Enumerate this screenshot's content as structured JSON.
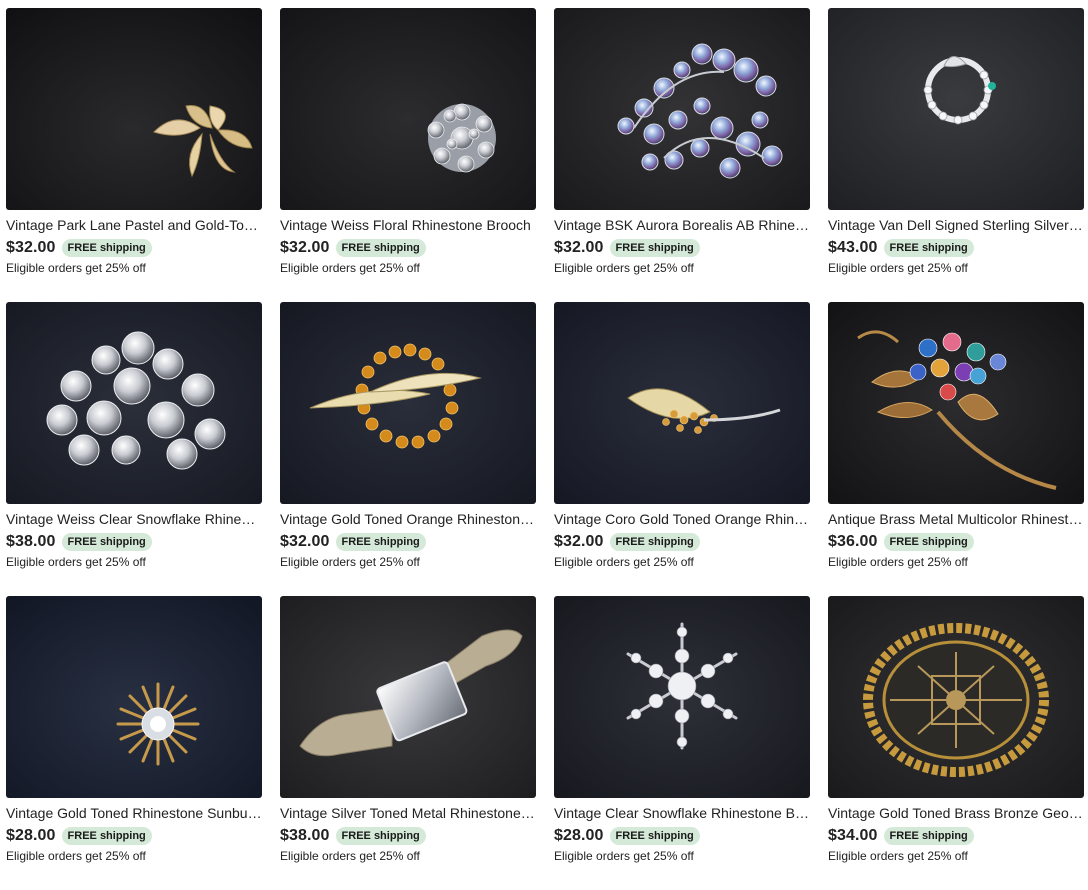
{
  "listings": [
    {
      "title": "Vintage Park Lane Pastel and Gold-Tone Leaf Brooch",
      "price": "$32.00",
      "shipping": "FREE shipping",
      "promo": "Eligible orders get 25% off",
      "image_icon": "brooch-photo-icon"
    },
    {
      "title": "Vintage Weiss Floral Rhinestone Brooch",
      "price": "$32.00",
      "shipping": "FREE shipping",
      "promo": "Eligible orders get 25% off",
      "image_icon": "brooch-photo-icon"
    },
    {
      "title": "Vintage BSK Aurora Borealis AB Rhinestone Brooch",
      "price": "$32.00",
      "shipping": "FREE shipping",
      "promo": "Eligible orders get 25% off",
      "image_icon": "brooch-photo-icon"
    },
    {
      "title": "Vintage Van Dell Signed Sterling Silver Circle Brooch",
      "price": "$43.00",
      "shipping": "FREE shipping",
      "promo": "Eligible orders get 25% off",
      "image_icon": "brooch-photo-icon"
    },
    {
      "title": "Vintage Weiss Clear Snowflake Rhinestone Brooch",
      "price": "$38.00",
      "shipping": "FREE shipping",
      "promo": "Eligible orders get 25% off",
      "image_icon": "brooch-photo-icon"
    },
    {
      "title": "Vintage Gold Toned Orange Rhinestone Brooch",
      "price": "$32.00",
      "shipping": "FREE shipping",
      "promo": "Eligible orders get 25% off",
      "image_icon": "brooch-photo-icon"
    },
    {
      "title": "Vintage Coro Gold Toned Orange Rhinestone Leaf Brooch",
      "price": "$32.00",
      "shipping": "FREE shipping",
      "promo": "Eligible orders get 25% off",
      "image_icon": "brooch-photo-icon"
    },
    {
      "title": "Antique Brass Metal Multicolor Rhinestone Flower Brooch",
      "price": "$36.00",
      "shipping": "FREE shipping",
      "promo": "Eligible orders get 25% off",
      "image_icon": "brooch-photo-icon"
    },
    {
      "title": "Vintage Gold Toned Rhinestone Sunburst Brooch",
      "price": "$28.00",
      "shipping": "FREE shipping",
      "promo": "Eligible orders get 25% off",
      "image_icon": "brooch-photo-icon"
    },
    {
      "title": "Vintage Silver Toned Metal Rhinestone Snake Bar Brooch",
      "price": "$38.00",
      "shipping": "FREE shipping",
      "promo": "Eligible orders get 25% off",
      "image_icon": "brooch-photo-icon"
    },
    {
      "title": "Vintage Clear Snowflake Rhinestone Brooch",
      "price": "$28.00",
      "shipping": "FREE shipping",
      "promo": "Eligible orders get 25% off",
      "image_icon": "brooch-photo-icon"
    },
    {
      "title": "Vintage Gold Toned Brass Bronze Geometric Brooch",
      "price": "$34.00",
      "shipping": "FREE shipping",
      "promo": "Eligible orders get 25% off",
      "image_icon": "brooch-photo-icon"
    }
  ],
  "colors": {
    "badge_bg": "#d4e9d7",
    "text": "#222222",
    "photo_bg": "#1e2126"
  }
}
